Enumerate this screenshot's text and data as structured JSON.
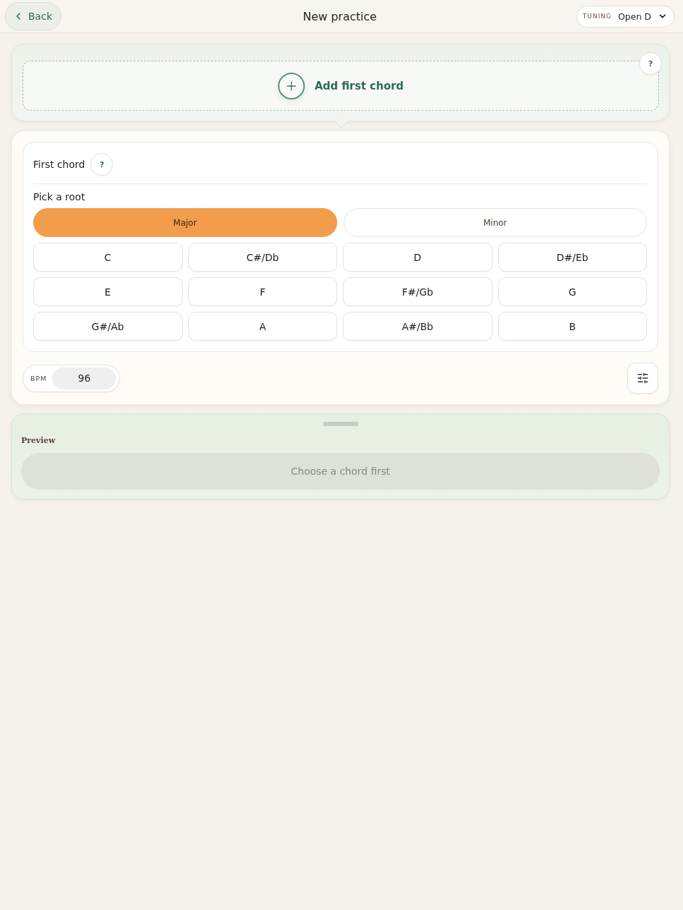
{
  "header": {
    "back": "Back",
    "title": "New practice",
    "tuning": {
      "label": "TUNING",
      "value": "Open D"
    }
  },
  "add_chord": {
    "label": "Add first chord",
    "help": "?"
  },
  "chord_editor": {
    "title": "First chord",
    "help": "?",
    "section": "Pick a root",
    "modes": [
      {
        "label": "Major",
        "selected": true
      },
      {
        "label": "Minor",
        "selected": false
      }
    ],
    "roots": [
      {
        "label": "C",
        "selected": false
      },
      {
        "label": "C#/Db",
        "selected": false
      },
      {
        "label": "D",
        "selected": false
      },
      {
        "label": "D#/Eb",
        "selected": false
      },
      {
        "label": "E",
        "selected": false
      },
      {
        "label": "F",
        "selected": false
      },
      {
        "label": "F#/Gb",
        "selected": false
      },
      {
        "label": "G",
        "selected": false
      },
      {
        "label": "G#/Ab",
        "selected": false
      },
      {
        "label": "A",
        "selected": false
      },
      {
        "label": "A#/Bb",
        "selected": false
      },
      {
        "label": "B",
        "selected": false
      }
    ]
  },
  "bpm": {
    "label": "BPM",
    "value": "96"
  },
  "preview": {
    "title": "Preview",
    "button": {
      "label": "Choose a chord first",
      "disabled": true
    }
  }
}
